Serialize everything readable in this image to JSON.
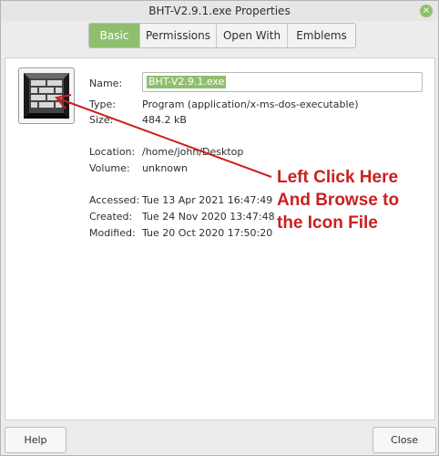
{
  "window": {
    "title": "BHT-V2.9.1.exe Properties",
    "close_glyph": "×"
  },
  "tabs": [
    {
      "label": "Basic",
      "active": true
    },
    {
      "label": "Permissions",
      "active": false
    },
    {
      "label": "Open With",
      "active": false
    },
    {
      "label": "Emblems",
      "active": false
    }
  ],
  "file_icon": {
    "icon": "brick-wall-icon"
  },
  "fields": {
    "name": {
      "label": "Name:",
      "value": "BHT-V2.9.1.exe"
    },
    "type": {
      "label": "Type:",
      "value": "Program (application/x-ms-dos-executable)"
    },
    "size": {
      "label": "Size:",
      "value": "484.2 kB"
    },
    "location": {
      "label": "Location:",
      "value": "/home/john/Desktop"
    },
    "volume": {
      "label": "Volume:",
      "value": "unknown"
    },
    "accessed": {
      "label": "Accessed:",
      "value": "Tue 13 Apr 2021 16:47:49"
    },
    "created": {
      "label": "Created:",
      "value": "Tue 24 Nov 2020 13:47:48"
    },
    "modified": {
      "label": "Modified:",
      "value": "Tue 20 Oct 2020 17:50:20"
    }
  },
  "annotation": {
    "line1": "Left Click Here",
    "line2": "And Browse to",
    "line3": "the Icon File",
    "color": "#cc1f1f"
  },
  "buttons": {
    "help": "Help",
    "close": "Close"
  },
  "colors": {
    "accent": "#8fbf6e"
  }
}
